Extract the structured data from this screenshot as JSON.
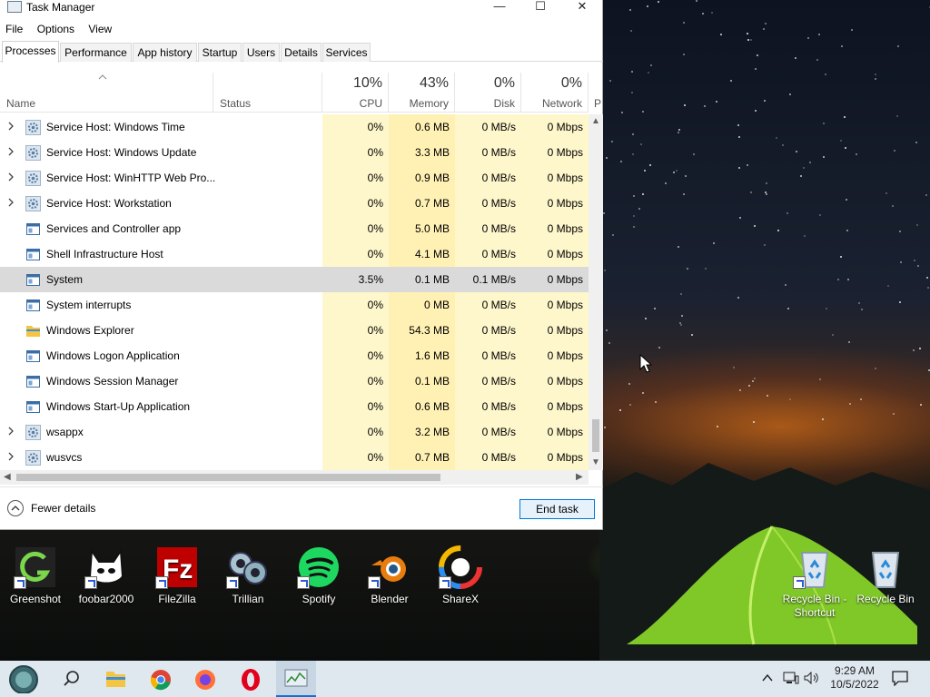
{
  "window": {
    "title": "Task Manager",
    "minimize": "—",
    "maximize": "☐",
    "close": "✕"
  },
  "menu": [
    "File",
    "Options",
    "View"
  ],
  "tabs": [
    "Processes",
    "Performance",
    "App history",
    "Startup",
    "Users",
    "Details",
    "Services"
  ],
  "columns": {
    "name": "Name",
    "status": "Status",
    "cpu": {
      "percent": "10%",
      "label": "CPU"
    },
    "memory": {
      "percent": "43%",
      "label": "Memory"
    },
    "disk": {
      "percent": "0%",
      "label": "Disk"
    },
    "network": {
      "percent": "0%",
      "label": "Network"
    },
    "next": "P"
  },
  "processes": [
    {
      "name": "Service Host: Windows Time",
      "cpu": "0%",
      "memory": "0.6 MB",
      "disk": "0 MB/s",
      "network": "0 Mbps",
      "expandable": true,
      "icon": "gear-icon"
    },
    {
      "name": "Service Host: Windows Update",
      "cpu": "0%",
      "memory": "3.3 MB",
      "disk": "0 MB/s",
      "network": "0 Mbps",
      "expandable": true,
      "icon": "gear-icon"
    },
    {
      "name": "Service Host: WinHTTP Web Pro...",
      "cpu": "0%",
      "memory": "0.9 MB",
      "disk": "0 MB/s",
      "network": "0 Mbps",
      "expandable": true,
      "icon": "gear-icon"
    },
    {
      "name": "Service Host: Workstation",
      "cpu": "0%",
      "memory": "0.7 MB",
      "disk": "0 MB/s",
      "network": "0 Mbps",
      "expandable": true,
      "icon": "gear-icon"
    },
    {
      "name": "Services and Controller app",
      "cpu": "0%",
      "memory": "5.0 MB",
      "disk": "0 MB/s",
      "network": "0 Mbps",
      "expandable": false,
      "icon": "app-window-icon"
    },
    {
      "name": "Shell Infrastructure Host",
      "cpu": "0%",
      "memory": "4.1 MB",
      "disk": "0 MB/s",
      "network": "0 Mbps",
      "expandable": false,
      "icon": "app-window-icon"
    },
    {
      "name": "System",
      "cpu": "3.5%",
      "memory": "0.1 MB",
      "disk": "0.1 MB/s",
      "network": "0 Mbps",
      "expandable": false,
      "icon": "app-window-icon",
      "selected": true
    },
    {
      "name": "System interrupts",
      "cpu": "0%",
      "memory": "0 MB",
      "disk": "0 MB/s",
      "network": "0 Mbps",
      "expandable": false,
      "icon": "app-window-icon"
    },
    {
      "name": "Windows Explorer",
      "cpu": "0%",
      "memory": "54.3 MB",
      "disk": "0 MB/s",
      "network": "0 Mbps",
      "expandable": false,
      "icon": "folder-icon"
    },
    {
      "name": "Windows Logon Application",
      "cpu": "0%",
      "memory": "1.6 MB",
      "disk": "0 MB/s",
      "network": "0 Mbps",
      "expandable": false,
      "icon": "app-window-icon"
    },
    {
      "name": "Windows Session Manager",
      "cpu": "0%",
      "memory": "0.1 MB",
      "disk": "0 MB/s",
      "network": "0 Mbps",
      "expandable": false,
      "icon": "app-window-icon"
    },
    {
      "name": "Windows Start-Up Application",
      "cpu": "0%",
      "memory": "0.6 MB",
      "disk": "0 MB/s",
      "network": "0 Mbps",
      "expandable": false,
      "icon": "app-window-icon"
    },
    {
      "name": "wsappx",
      "cpu": "0%",
      "memory": "3.2 MB",
      "disk": "0 MB/s",
      "network": "0 Mbps",
      "expandable": true,
      "icon": "gear-icon"
    },
    {
      "name": "wusvcs",
      "cpu": "0%",
      "memory": "0.7 MB",
      "disk": "0 MB/s",
      "network": "0 Mbps",
      "expandable": true,
      "icon": "gear-icon"
    }
  ],
  "footer": {
    "fewer_details": "Fewer details",
    "end_task": "End task"
  },
  "desktop_icons": [
    {
      "label": "Greenshot",
      "icon": "greenshot-icon",
      "color": "#2b8a2b"
    },
    {
      "label": "foobar2000",
      "icon": "foobar2000-icon",
      "color": "#ffffff"
    },
    {
      "label": "FileZilla",
      "icon": "filezilla-icon",
      "color": "#bf0000"
    },
    {
      "label": "Trillian",
      "icon": "trillian-icon",
      "color": "#7fb0c8"
    },
    {
      "label": "Spotify",
      "icon": "spotify-icon",
      "color": "#1ed760"
    },
    {
      "label": "Blender",
      "icon": "blender-icon",
      "color": "#e87d0d"
    },
    {
      "label": "ShareX",
      "icon": "sharex-icon",
      "color": "#2d8cf0"
    },
    {
      "label": "Recycle Bin - Shortcut",
      "icon": "recycle-bin-icon",
      "color": "#cfd8e0"
    },
    {
      "label": "Recycle Bin",
      "icon": "recycle-bin-icon",
      "color": "#cfd8e0"
    }
  ],
  "taskbar": {
    "pinned": [
      "start-icon",
      "search-icon",
      "file-explorer-icon",
      "chrome-icon",
      "firefox-icon",
      "opera-icon",
      "task-manager-icon"
    ],
    "time": "9:29 AM",
    "date": "10/5/2022"
  },
  "colors": {
    "accent": "#0078d7",
    "heat_light": "#fff7cc",
    "heat_medium": "#fff0b4",
    "selected_row": "#dadada",
    "taskbar": "#dfe7ef"
  }
}
